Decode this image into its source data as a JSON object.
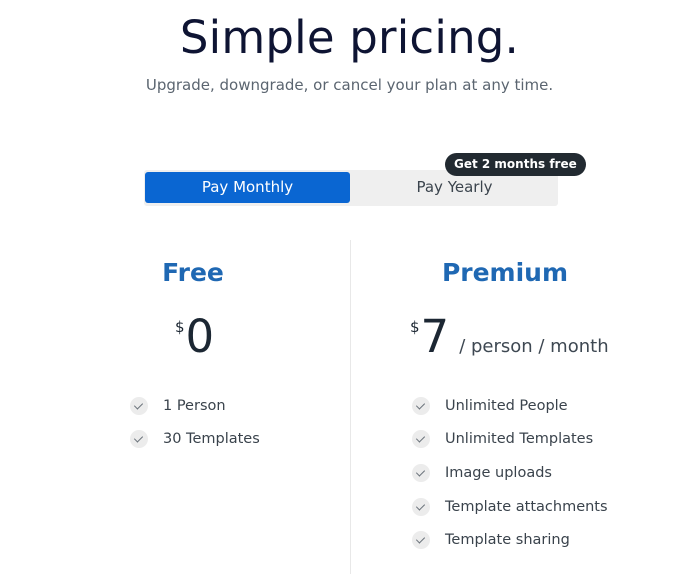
{
  "header": {
    "title": "Simple pricing.",
    "subtitle": "Upgrade, downgrade, or cancel your plan at any time."
  },
  "billing_toggle": {
    "options": [
      "Pay Monthly",
      "Pay Yearly"
    ],
    "selected": "Pay Monthly",
    "badge": "Get 2 months free"
  },
  "plans": [
    {
      "name": "Free",
      "currency": "$",
      "price": "0",
      "period": "",
      "features": [
        "1 Person",
        "30 Templates"
      ]
    },
    {
      "name": "Premium",
      "currency": "$",
      "price": "7",
      "period": "/ person / month",
      "features": [
        "Unlimited People",
        "Unlimited Templates",
        "Image uploads",
        "Template attachments",
        "Template sharing"
      ]
    }
  ],
  "colors": {
    "accent": "#0a66d2",
    "plan_name": "#1f68b3",
    "title": "#0e1433",
    "badge_bg": "#222a31"
  },
  "icons": {
    "feature_bullet": "check-icon"
  }
}
